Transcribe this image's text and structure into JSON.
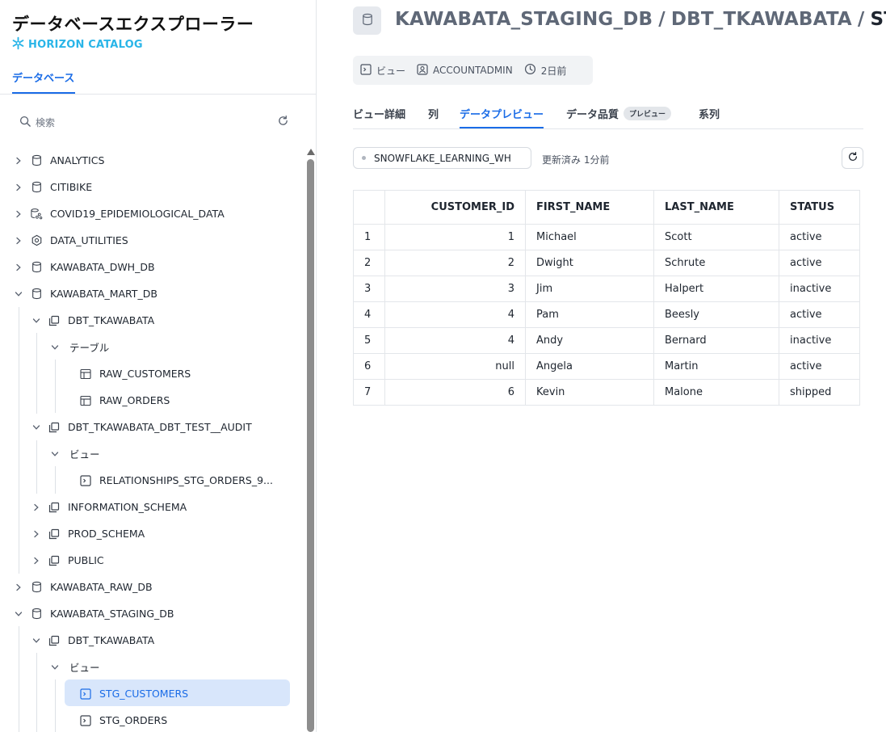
{
  "sidebar": {
    "title": "データベースエクスプローラー",
    "brand": "HORIZON CATALOG",
    "tab": "データベース",
    "search_placeholder": "検索",
    "tree": [
      {
        "label": "ANALYTICS",
        "icon": "database-icon",
        "expanded": false
      },
      {
        "label": "CITIBIKE",
        "icon": "database-icon",
        "expanded": false
      },
      {
        "label": "COVID19_EPIDEMIOLOGICAL_DATA",
        "icon": "shared-database-icon",
        "expanded": false
      },
      {
        "label": "DATA_UTILITIES",
        "icon": "app-database-icon",
        "expanded": false
      },
      {
        "label": "KAWABATA_DWH_DB",
        "icon": "database-icon",
        "expanded": false
      },
      {
        "label": "KAWABATA_MART_DB",
        "icon": "database-icon",
        "expanded": true
      },
      {
        "label": "DBT_TKAWABATA",
        "icon": "schema-icon",
        "expanded": true
      },
      {
        "label": "テーブル",
        "icon": "",
        "expanded": true
      },
      {
        "label": "RAW_CUSTOMERS",
        "icon": "table-icon"
      },
      {
        "label": "RAW_ORDERS",
        "icon": "table-icon"
      },
      {
        "label": "DBT_TKAWABATA_DBT_TEST__AUDIT",
        "icon": "schema-icon",
        "expanded": true
      },
      {
        "label": "ビュー",
        "icon": "",
        "expanded": true
      },
      {
        "label": "RELATIONSHIPS_STG_ORDERS_9...",
        "icon": "view-icon"
      },
      {
        "label": "INFORMATION_SCHEMA",
        "icon": "schema-icon",
        "expanded": false
      },
      {
        "label": "PROD_SCHEMA",
        "icon": "schema-icon",
        "expanded": false
      },
      {
        "label": "PUBLIC",
        "icon": "schema-icon",
        "expanded": false
      },
      {
        "label": "KAWABATA_RAW_DB",
        "icon": "database-icon",
        "expanded": false
      },
      {
        "label": "KAWABATA_STAGING_DB",
        "icon": "database-icon",
        "expanded": true
      },
      {
        "label": "DBT_TKAWABATA",
        "icon": "schema-icon",
        "expanded": true
      },
      {
        "label": "ビュー",
        "icon": "",
        "expanded": true
      },
      {
        "label": "STG_CUSTOMERS",
        "icon": "view-icon",
        "selected": true
      },
      {
        "label": "STG_ORDERS",
        "icon": "view-icon"
      }
    ]
  },
  "header": {
    "breadcrumb": [
      "KAWABATA_STAGING_DB",
      "DBT_TKAWABATA",
      "STG_CUS"
    ],
    "separator": "/",
    "meta": {
      "type": "ビュー",
      "owner": "ACCOUNTADMIN",
      "modified": "2日前"
    }
  },
  "tabs": [
    {
      "label": "ビュー詳細",
      "active": false
    },
    {
      "label": "列",
      "active": false
    },
    {
      "label": "データプレビュー",
      "active": true
    },
    {
      "label": "データ品質",
      "badge": "プレビュー",
      "active": false
    },
    {
      "label": "系列",
      "active": false
    }
  ],
  "toolbar": {
    "warehouse": "SNOWFLAKE_LEARNING_WH",
    "updated": "更新済み 1分前"
  },
  "table": {
    "columns": [
      "CUSTOMER_ID",
      "FIRST_NAME",
      "LAST_NAME",
      "STATUS"
    ],
    "rows": [
      {
        "idx": "1",
        "cells": [
          "1",
          "Michael",
          "Scott",
          "active"
        ]
      },
      {
        "idx": "2",
        "cells": [
          "2",
          "Dwight",
          "Schrute",
          "active"
        ]
      },
      {
        "idx": "3",
        "cells": [
          "3",
          "Jim",
          "Halpert",
          "inactive"
        ]
      },
      {
        "idx": "4",
        "cells": [
          "4",
          "Pam",
          "Beesly",
          "active"
        ]
      },
      {
        "idx": "5",
        "cells": [
          "4",
          "Andy",
          "Bernard",
          "inactive"
        ]
      },
      {
        "idx": "6",
        "cells": [
          "null",
          "Angela",
          "Martin",
          "active"
        ]
      },
      {
        "idx": "7",
        "cells": [
          "6",
          "Kevin",
          "Malone",
          "shipped"
        ]
      }
    ]
  },
  "colors": {
    "accent": "#1a6ce7",
    "brand": "#29b5e8",
    "selected_bg": "#d8e6fb"
  }
}
